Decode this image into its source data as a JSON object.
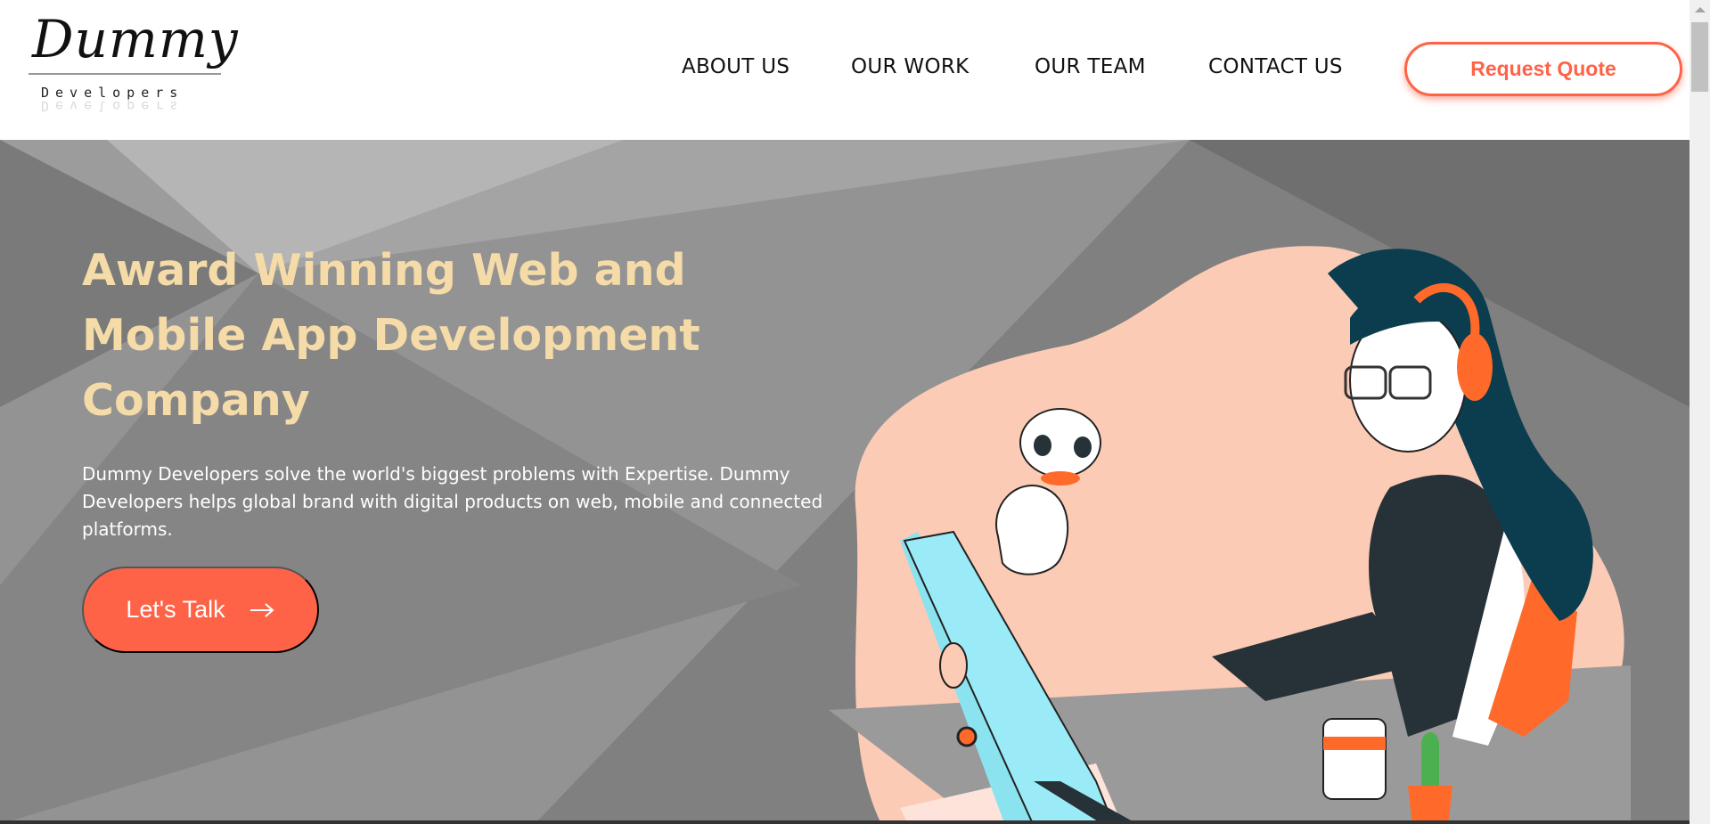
{
  "logo": {
    "script": "Dummy",
    "sub": "Developers"
  },
  "nav": [
    {
      "label": "ABOUT US"
    },
    {
      "label": "OUR WORK"
    },
    {
      "label": "OUR TEAM"
    },
    {
      "label": "CONTACT US"
    }
  ],
  "header": {
    "cta": "Request Quote"
  },
  "hero": {
    "title": "Award Winning Web and Mobile App Development Company",
    "description": "Dummy Developers solve the world's biggest problems with Expertise. Dummy Developers helps global brand with digital products on web, mobile and connected platforms.",
    "button": "Let's Talk",
    "button_icon": "arrow-right-icon"
  },
  "colors": {
    "accent": "#ff6347",
    "title": "#f5dba8",
    "blob": "#fccbb5"
  }
}
